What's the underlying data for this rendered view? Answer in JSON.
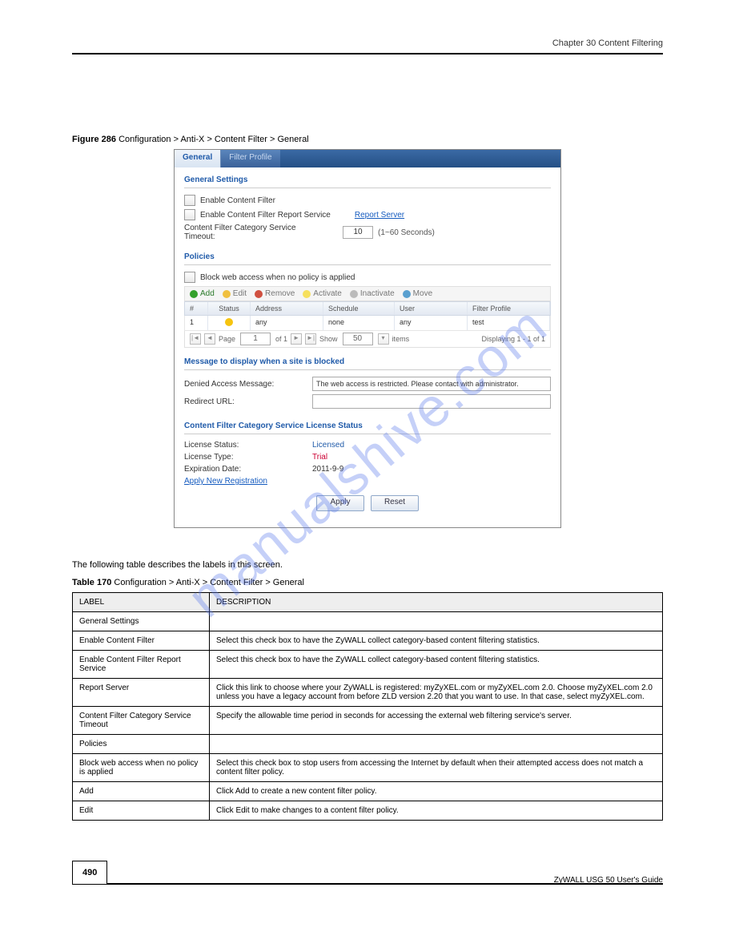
{
  "header": {
    "chapter": "Chapter 30 Content Filtering"
  },
  "figure": {
    "lead": "Figure 286   ",
    "path": "Configuration > Anti-X > Content Filter > General"
  },
  "ui": {
    "tabs": {
      "general": "General",
      "filter_profile": "Filter Profile"
    },
    "general_settings": {
      "title": "General Settings",
      "enable_cf": "Enable Content Filter",
      "enable_report": "Enable Content Filter Report Service",
      "report_server": "Report Server",
      "timeout_label": "Content Filter Category Service Timeout:",
      "timeout_value": "10",
      "timeout_helper": "(1~60 Seconds)"
    },
    "policies": {
      "title": "Policies",
      "block_no_policy": "Block web access when no policy is applied",
      "tb_add": "Add",
      "tb_edit": "Edit",
      "tb_remove": "Remove",
      "tb_activate": "Activate",
      "tb_inactivate": "Inactivate",
      "tb_move": "Move",
      "cols": {
        "idx": "#",
        "status": "Status",
        "address": "Address",
        "schedule": "Schedule",
        "user": "User",
        "fp": "Filter Profile"
      },
      "row": {
        "idx": "1",
        "address": "any",
        "schedule": "none",
        "user": "any",
        "fp": "test"
      },
      "pager": {
        "page_label": "Page",
        "page_val": "1",
        "of": "of 1",
        "show": "Show",
        "show_val": "50",
        "items": "items",
        "display": "Displaying 1 - 1 of 1"
      }
    },
    "blocked": {
      "title": "Message to display when a site is blocked",
      "denied_label": "Denied Access Message:",
      "denied_value": "The web access is restricted. Please contact with administrator.",
      "redirect_label": "Redirect URL:"
    },
    "license": {
      "title": "Content Filter Category Service License Status",
      "status_label": "License Status:",
      "status_value": "Licensed",
      "type_label": "License Type:",
      "type_value": "Trial",
      "exp_label": "Expiration Date:",
      "exp_value": "2011-9-9",
      "apply_new": "Apply New Registration"
    },
    "buttons": {
      "apply": "Apply",
      "reset": "Reset"
    }
  },
  "tableDoc": {
    "caption_lead": "Table 170   ",
    "caption_path": "Configuration > Anti-X > Content Filter > General",
    "th_label": "LABEL",
    "th_desc": "DESCRIPTION",
    "rows": [
      {
        "label": "General Settings",
        "desc": ""
      },
      {
        "label": "Enable Content Filter",
        "desc": "Select this check box to have the ZyWALL collect category-based content filtering statistics."
      },
      {
        "label": "Enable Content Filter Report Service",
        "desc": "Select this check box to have the ZyWALL collect category-based content filtering statistics."
      },
      {
        "label": "Report Server",
        "desc": "Click this link to choose where your ZyWALL is registered: myZyXEL.com or myZyXEL.com 2.0. Choose myZyXEL.com 2.0 unless you have a legacy account from before ZLD version 2.20 that you want to use. In that case, select myZyXEL.com."
      },
      {
        "label": "Content Filter Category Service Timeout",
        "desc": "Specify the allowable time period in seconds for accessing the external web filtering service's server."
      },
      {
        "label": "Policies",
        "desc": ""
      },
      {
        "label": "Block web access when no policy is applied",
        "desc": "Select this check box to stop users from accessing the Internet by default when their attempted access does not match a content filter policy."
      },
      {
        "label": "Add",
        "desc": "Click Add to create a new content filter policy."
      },
      {
        "label": "Edit",
        "desc": "Click Edit to make changes to a content filter policy."
      }
    ]
  },
  "watermark": "manualshive.com",
  "footer": {
    "page": "490",
    "title": "ZyWALL USG 50 User's Guide"
  }
}
